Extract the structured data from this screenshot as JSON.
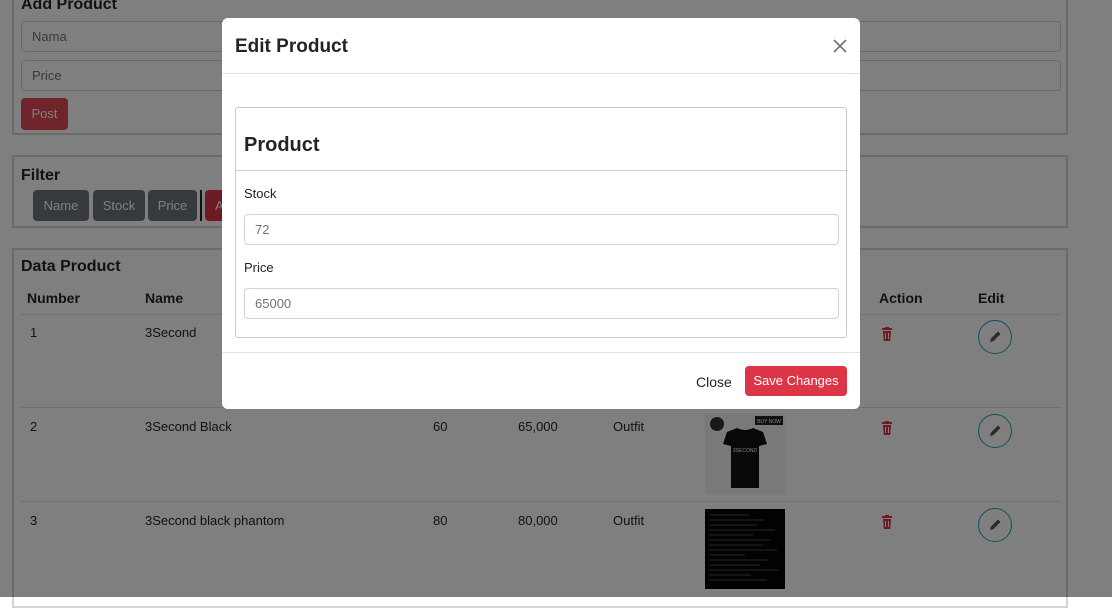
{
  "add_product": {
    "title": "Add Product",
    "name_placeholder": "Nama",
    "price_placeholder": "Price",
    "post_label": "Post"
  },
  "filter": {
    "title": "Filter",
    "buttons": [
      "Name",
      "Stock",
      "Price",
      "A"
    ]
  },
  "data_product": {
    "title": "Data Product",
    "headers": {
      "number": "Number",
      "name": "Name",
      "action": "Action",
      "edit": "Edit"
    },
    "rows": [
      {
        "number": "1",
        "name": "3Second",
        "stock": "",
        "price": "",
        "category": ""
      },
      {
        "number": "2",
        "name": "3Second Black",
        "stock": "60",
        "price": "65,000",
        "category": "Outfit"
      },
      {
        "number": "3",
        "name": "3Second black phantom",
        "stock": "80",
        "price": "80,000",
        "category": "Outfit"
      }
    ],
    "thumb_labels": {
      "buy_now": "BUY NOW",
      "brand": "3SECOND"
    }
  },
  "modal": {
    "title": "Edit Product",
    "section_title": "Product",
    "stock_label": "Stock",
    "stock_value": "72",
    "price_label": "Price",
    "price_value": "65000",
    "close_label": "Close",
    "save_label": "Save Changes"
  },
  "colors": {
    "danger": "#dc3545",
    "secondary": "#6c757d",
    "info": "#17a2b8",
    "backdrop": "rgba(0,0,0,0.5)"
  },
  "icons": [
    "trash-icon",
    "pencil-icon",
    "close-icon"
  ]
}
